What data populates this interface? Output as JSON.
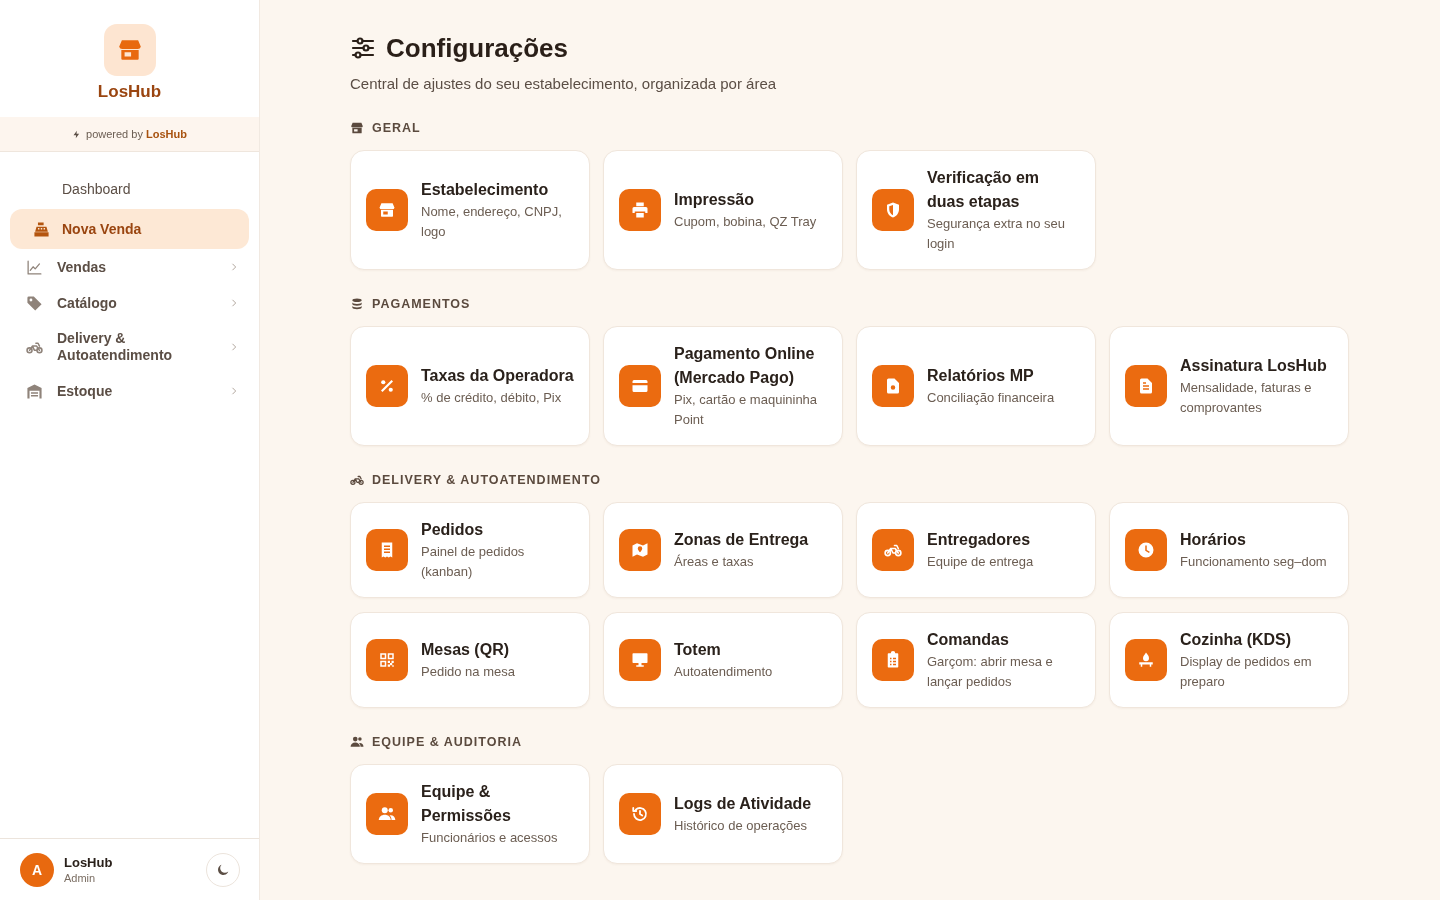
{
  "sidebar": {
    "brand": {
      "name": "LosHub"
    },
    "powered_by": "powered by **LosHub**",
    "nav": [
      {
        "label": "Dashboard",
        "kind": "link",
        "selected": false
      },
      {
        "label": "Nova Venda",
        "kind": "link",
        "selected": true
      },
      {
        "label": "Vendas",
        "kind": "group",
        "selected": false,
        "expanded": false
      },
      {
        "label": "Catálogo",
        "kind": "group",
        "selected": false,
        "expanded": false
      },
      {
        "label": "Delivery & Autoatendimento",
        "kind": "group",
        "selected": false,
        "expanded": false
      },
      {
        "label": "Estoque",
        "kind": "group",
        "selected": false,
        "expanded": false
      }
    ],
    "user": {
      "initial": "A",
      "name": "LosHub",
      "role": "Admin"
    }
  },
  "header": {
    "title": "Configurações",
    "subtitle": "Central de ajustes do seu estabelecimento, organizada por área"
  },
  "sections": [
    {
      "title": "GERAL",
      "cards": [
        {
          "title": "Estabelecimento",
          "description": "Nome, endereço, CNPJ, logo"
        },
        {
          "title": "Impressão",
          "description": "Cupom, bobina, QZ Tray"
        },
        {
          "title": "Verificação em duas etapas",
          "description": "Segurança extra no seu login"
        }
      ]
    },
    {
      "title": "PAGAMENTOS",
      "cards": [
        {
          "title": "Taxas da Operadora",
          "description": "% de crédito, débito, Pix"
        },
        {
          "title": "Pagamento Online (Mercado Pago)",
          "description": "Pix, cartão e maquininha Point"
        },
        {
          "title": "Relatórios MP",
          "description": "Conciliação financeira"
        },
        {
          "title": "Assinatura LosHub",
          "description": "Mensalidade, faturas e comprovantes"
        }
      ]
    },
    {
      "title": "DELIVERY & AUTOATENDIMENTO",
      "cards": [
        {
          "title": "Pedidos",
          "description": "Painel de pedidos (kanban)"
        },
        {
          "title": "Zonas de Entrega",
          "description": "Áreas e taxas"
        },
        {
          "title": "Entregadores",
          "description": "Equipe de entrega"
        },
        {
          "title": "Horários",
          "description": "Funcionamento seg–dom"
        },
        {
          "title": "Mesas (QR)",
          "description": "Pedido na mesa"
        },
        {
          "title": "Totem",
          "description": "Autoatendimento"
        },
        {
          "title": "Comandas",
          "description": "Garçom: abrir mesa e lançar pedidos"
        },
        {
          "title": "Cozinha (KDS)",
          "description": "Display de pedidos em preparo"
        }
      ]
    },
    {
      "title": "EQUIPE & AUDITORIA",
      "cards": [
        {
          "title": "Equipe & Permissões",
          "description": "Funcionários e acessos"
        },
        {
          "title": "Logs de Atividade",
          "description": "Histórico de operações"
        }
      ]
    }
  ]
}
